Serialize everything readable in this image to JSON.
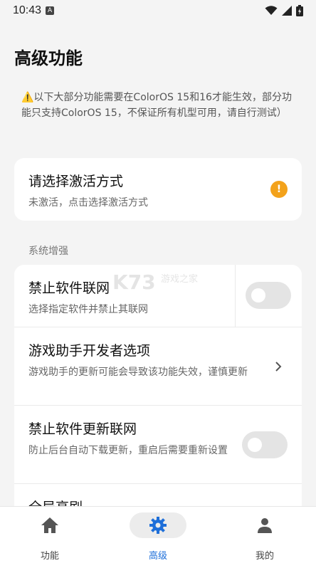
{
  "status_bar": {
    "time": "10:43",
    "badge": "A",
    "icons": [
      "wifi-icon",
      "signal-icon",
      "battery-icon"
    ]
  },
  "page": {
    "title": "高级功能",
    "notice": "⚠️以下大部分功能需要在ColorOS 15和16才能生效，部分功能只支持ColorOS 15，不保证所有机型可用，请自行测试）"
  },
  "activation": {
    "title": "请选择激活方式",
    "subtitle": "未激活，点击选择激活方式",
    "warn_symbol": "!",
    "warn_color": "#f3a21b"
  },
  "section": {
    "label": "系统增强"
  },
  "items": [
    {
      "title": "禁止软件联网",
      "subtitle": "选择指定软件并禁止其联网",
      "control": "toggle",
      "on": false
    },
    {
      "title": "游戏助手开发者选项",
      "subtitle": "游戏助手的更新可能会导致该功能失效，谨慎更新",
      "control": "chevron"
    },
    {
      "title": "禁止软件更新联网",
      "subtitle": "防止后台自动下载更新，重启后需要重新设置",
      "control": "toggle",
      "on": false
    },
    {
      "title": "全局高刷",
      "subtitle": ""
    }
  ],
  "watermark": {
    "brand": "K73",
    "text": "游戏之家"
  },
  "nav": {
    "accent": "#1e6fd9",
    "items": [
      {
        "label": "功能",
        "icon": "home-icon",
        "active": false
      },
      {
        "label": "高级",
        "icon": "gear-icon",
        "active": true
      },
      {
        "label": "我的",
        "icon": "person-icon",
        "active": false
      }
    ]
  }
}
